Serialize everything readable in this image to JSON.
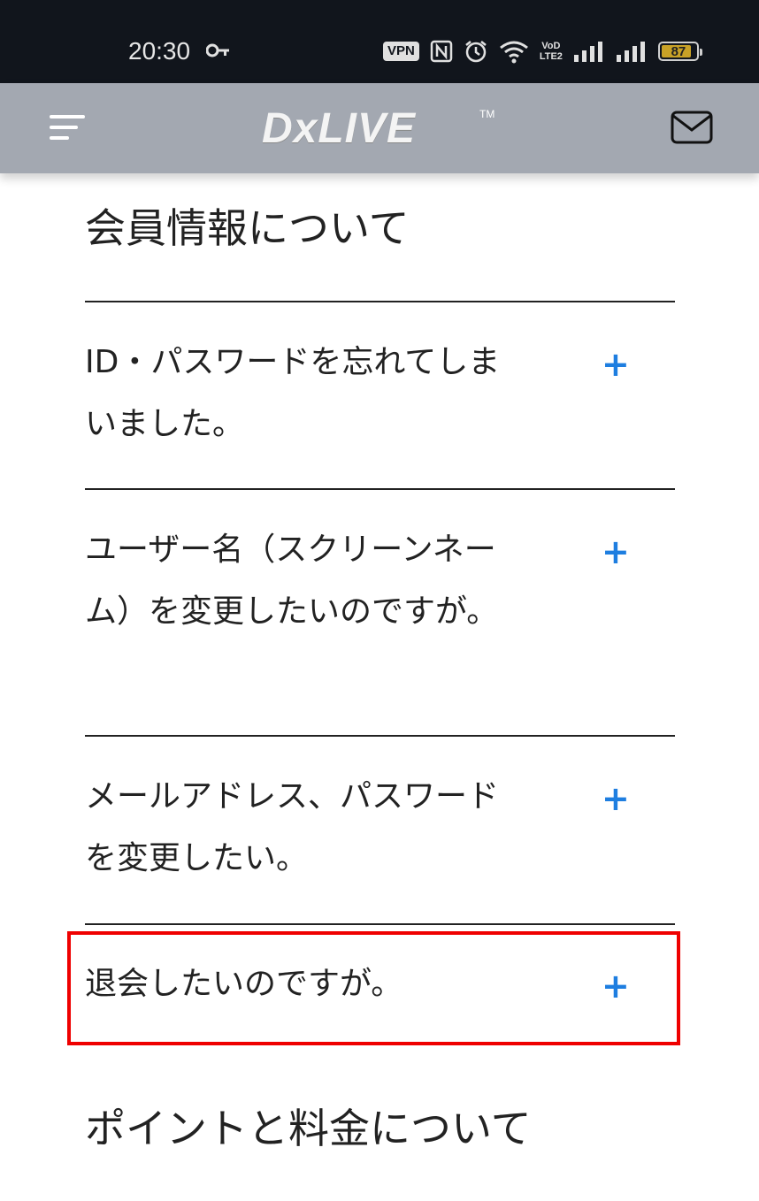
{
  "status_bar": {
    "time": "20:30",
    "vpn": "VPN",
    "volte_top": "VoD",
    "volte_bottom": "LTE2",
    "battery": "87",
    "battery_level": 0.87,
    "icons": [
      "key-icon",
      "nfc-icon",
      "alarm-icon",
      "wifi-icon",
      "signal-icon",
      "signal-icon"
    ]
  },
  "header": {
    "logo": "DxLIVE",
    "logo_tm": "TM",
    "menu_icon": "hamburger-menu-icon",
    "mail_icon": "mail-icon"
  },
  "sections": [
    {
      "title": "会員情報について",
      "items": [
        {
          "question": "ID・パスワードを忘れてしまいました。"
        },
        {
          "question": "ユーザー名（スクリーンネーム）を変更したいのですが。"
        },
        {
          "question": "メールアドレス、パスワードを変更したい。"
        },
        {
          "question": "退会したいのですが。"
        }
      ]
    },
    {
      "title": "ポイントと料金について"
    }
  ],
  "expand_symbol": "+",
  "colors": {
    "status_bar": "#11151c",
    "header": "#a3a8b1",
    "accent": "#1e7ee0",
    "highlight": "#ef0000"
  }
}
